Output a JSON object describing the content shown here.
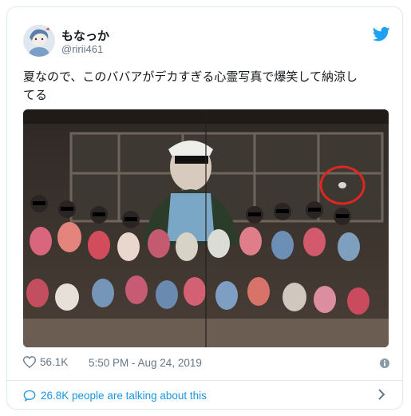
{
  "tweet": {
    "display_name": "もなっか",
    "handle": "@ririi461",
    "text_line1": "夏なので、このババアがデカすぎる心霊写真で爆笑して納涼し",
    "text_line2": "てる",
    "likes": "56.1K",
    "timestamp": "5:50 PM - Aug 24, 2019",
    "talking": "26.8K people are talking about this"
  },
  "colors": {
    "twitter_blue": "#1da1f2",
    "link_blue": "#1b95e0",
    "muted_gray": "#657786",
    "border": "#e1e8ed",
    "highlight_circle": "#e0271f"
  },
  "icons": {
    "brand": "twitter-bird-icon",
    "like": "heart-icon",
    "info": "info-icon",
    "talk": "comment-bubble-icon",
    "more": "chevron-right-icon"
  }
}
